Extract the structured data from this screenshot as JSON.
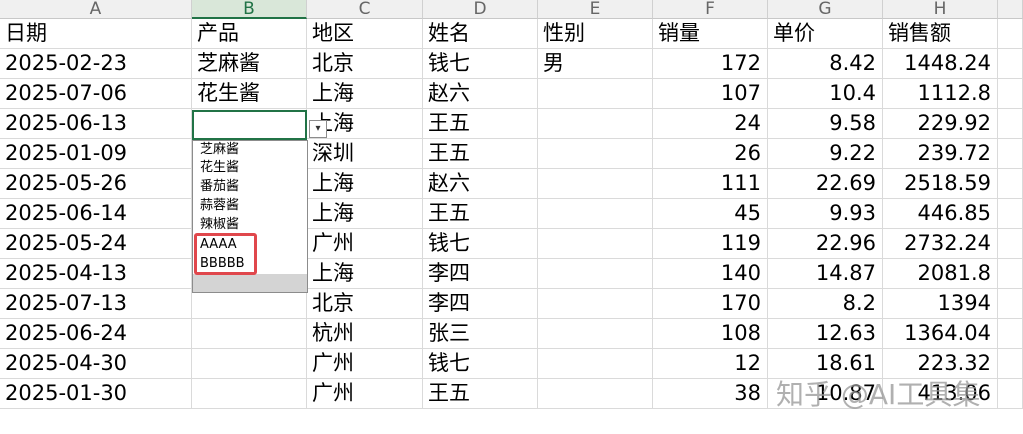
{
  "columns": [
    {
      "letter": "A",
      "active": false
    },
    {
      "letter": "B",
      "active": true
    },
    {
      "letter": "C",
      "active": false
    },
    {
      "letter": "D",
      "active": false
    },
    {
      "letter": "E",
      "active": false
    },
    {
      "letter": "F",
      "active": false
    },
    {
      "letter": "G",
      "active": false
    },
    {
      "letter": "H",
      "active": false
    }
  ],
  "headers": [
    "日期",
    "产品",
    "地区",
    "姓名",
    "性别",
    "销量",
    "单价",
    "销售额"
  ],
  "rows": [
    [
      "2025-02-23",
      "芝麻酱",
      "北京",
      "钱七",
      "男",
      "172",
      "8.42",
      "1448.24"
    ],
    [
      "2025-07-06",
      "花生酱",
      "上海",
      "赵六",
      "",
      "107",
      "10.4",
      "1112.8"
    ],
    [
      "2025-06-13",
      "",
      "上海",
      "王五",
      "",
      "24",
      "9.58",
      "229.92"
    ],
    [
      "2025-01-09",
      "",
      "深圳",
      "王五",
      "",
      "26",
      "9.22",
      "239.72"
    ],
    [
      "2025-05-26",
      "",
      "上海",
      "赵六",
      "",
      "111",
      "22.69",
      "2518.59"
    ],
    [
      "2025-06-14",
      "",
      "上海",
      "王五",
      "",
      "45",
      "9.93",
      "446.85"
    ],
    [
      "2025-05-24",
      "",
      "广州",
      "钱七",
      "",
      "119",
      "22.96",
      "2732.24"
    ],
    [
      "2025-04-13",
      "",
      "上海",
      "李四",
      "",
      "140",
      "14.87",
      "2081.8"
    ],
    [
      "2025-07-13",
      "",
      "北京",
      "李四",
      "",
      "170",
      "8.2",
      "1394"
    ],
    [
      "2025-06-24",
      "",
      "杭州",
      "张三",
      "",
      "108",
      "12.63",
      "1364.04"
    ],
    [
      "2025-04-30",
      "",
      "广州",
      "钱七",
      "",
      "12",
      "18.61",
      "223.32"
    ],
    [
      "2025-01-30",
      "",
      "广州",
      "王五",
      "",
      "38",
      "10.87",
      "413.06"
    ]
  ],
  "dropdown": {
    "options": [
      "芝麻酱",
      "花生酱",
      "番茄酱",
      "蒜蓉酱",
      "辣椒酱",
      "AAAA",
      "BBBBB"
    ],
    "arrow": "▾",
    "arrow_icon": "chevron-down-icon"
  },
  "watermark": "知乎 @AI工具集",
  "colors": {
    "accent": "#217346",
    "highlight": "#e0474c"
  }
}
